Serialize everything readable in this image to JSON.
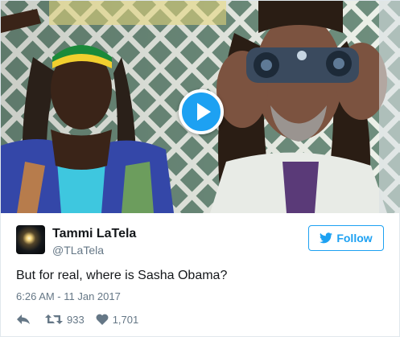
{
  "media": {
    "type": "video",
    "play_icon": "play-icon"
  },
  "author": {
    "name": "Tammi LaTela",
    "handle": "@TLaTela"
  },
  "follow_button": {
    "label": "Follow",
    "icon": "twitter-bird-icon"
  },
  "tweet": {
    "text": "But for real, where is Sasha Obama?",
    "timestamp": "6:26 AM - 11 Jan 2017"
  },
  "actions": {
    "reply_icon": "reply-icon",
    "retweet_icon": "retweet-icon",
    "retweet_count": "933",
    "like_icon": "heart-icon",
    "like_count": "1,701"
  },
  "colors": {
    "accent": "#1da1f2",
    "secondary_text": "#657786",
    "primary_text": "#14171a"
  }
}
